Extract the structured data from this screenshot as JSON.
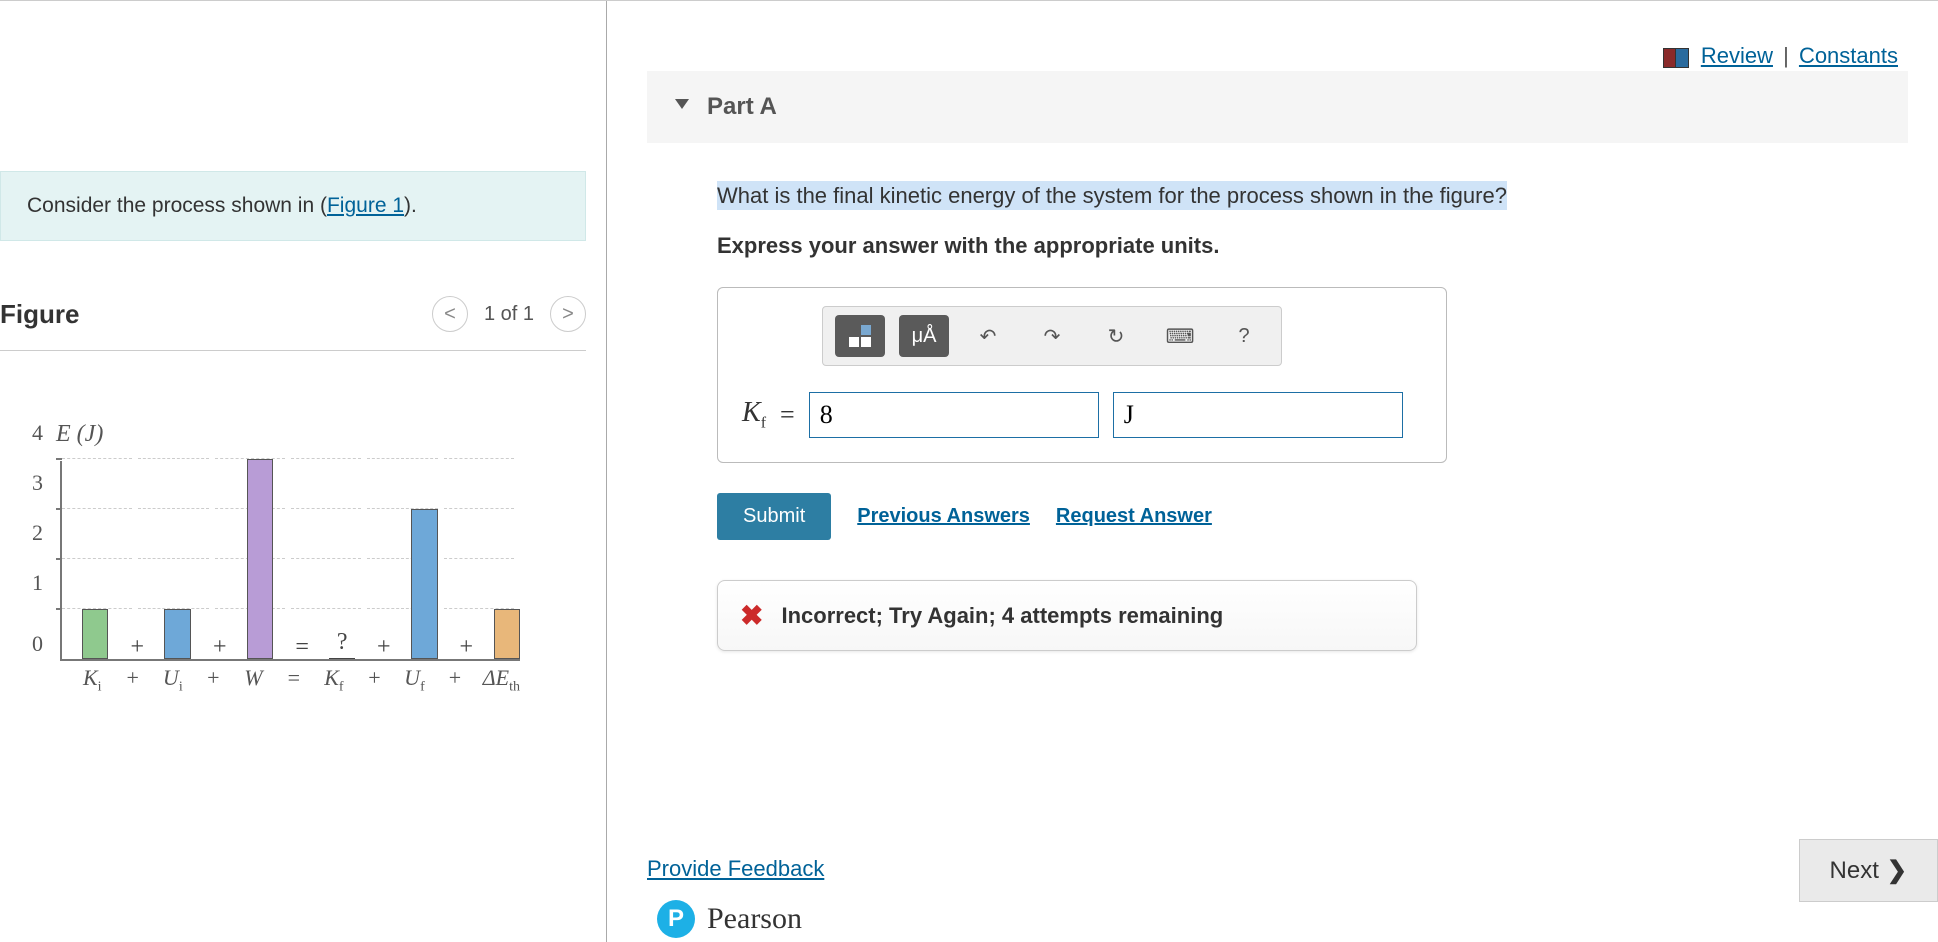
{
  "top_links": {
    "review": "Review",
    "constants": "Constants"
  },
  "prompt": {
    "pre": "Consider the process shown in (",
    "link": "Figure 1",
    "post": ")."
  },
  "figure": {
    "heading": "Figure",
    "pager": "1 of 1",
    "prev": "<",
    "next": ">"
  },
  "chart_data": {
    "type": "bar",
    "title": "",
    "ylabel": "E (J)",
    "xlabel": "",
    "ylim": [
      0,
      4
    ],
    "yticks": [
      0,
      1,
      2,
      3,
      4
    ],
    "categories": [
      "K_i",
      "U_i",
      "W",
      "K_f",
      "U_f",
      "ΔE_th"
    ],
    "values": [
      1,
      1,
      4,
      null,
      3,
      1
    ],
    "unknown_label": "?",
    "operators": [
      "+",
      "+",
      "=",
      "+",
      "+"
    ],
    "colors": [
      "#8fc98e",
      "#6ea8d8",
      "#b89cd6",
      null,
      "#6ea8d8",
      "#e8b77a"
    ],
    "equation_caption": "K_i + U_i + W = K_f + U_f + ΔE_th"
  },
  "part": {
    "label": "Part A"
  },
  "question": "What is the final kinetic energy of the system for the process shown in the figure?",
  "instruction": "Express your answer with the appropriate units.",
  "toolbar": {
    "templates": "templates",
    "units": "μÅ",
    "undo": "↶",
    "redo": "↷",
    "reset": "↻",
    "keyboard": "⌨",
    "help": "?"
  },
  "answer": {
    "var": "K",
    "sub": "f",
    "eq": "=",
    "value": "8",
    "unit": "J"
  },
  "actions": {
    "submit": "Submit",
    "previous": "Previous Answers",
    "request": "Request Answer"
  },
  "feedback": "Incorrect; Try Again; 4 attempts remaining",
  "provide_feedback": "Provide Feedback",
  "next": "Next",
  "brand": "Pearson"
}
